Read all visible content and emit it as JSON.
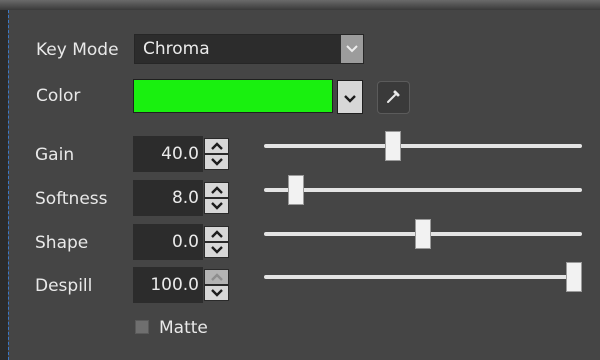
{
  "key_mode": {
    "label": "Key Mode",
    "value": "Chroma",
    "icon": "chevron-down-icon"
  },
  "color": {
    "label": "Color",
    "swatch": "#19f00f",
    "dropdown_icon": "chevron-down-icon",
    "picker_icon": "eyedropper-icon"
  },
  "params": [
    {
      "label": "Gain",
      "value": "40.0",
      "level": 0.4
    },
    {
      "label": "Softness",
      "value": "8.0",
      "level": 0.08
    },
    {
      "label": "Shape",
      "value": "0.0",
      "level": 0.5
    },
    {
      "label": "Despill",
      "value": "100.0",
      "level": 1.0
    }
  ],
  "matte": {
    "label": "Matte",
    "checked": false
  }
}
